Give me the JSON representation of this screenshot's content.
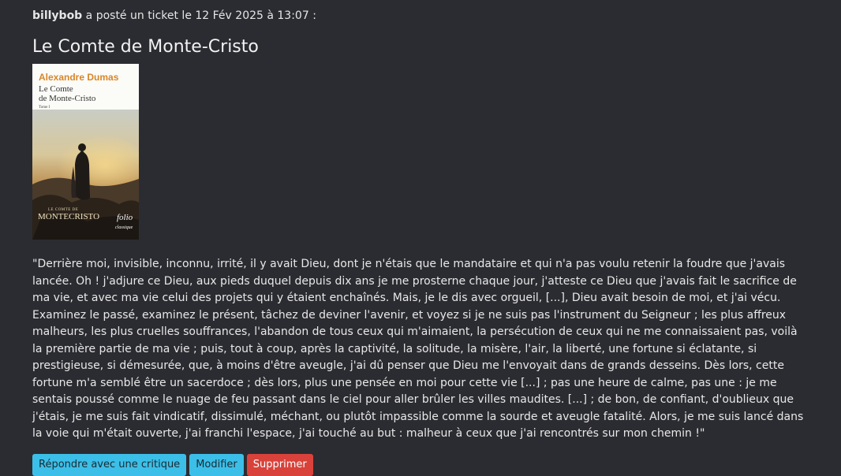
{
  "ticket": {
    "author": "billybob",
    "posted_text": " a posté un ticket le 12 Fév 2025 à 13:07 :",
    "title": "Le Comte de Monte-Cristo",
    "cover": {
      "author": "Alexandre Dumas",
      "title_line1": "Le Comte",
      "title_line2": "de Monte-Cristo",
      "tome": "Tome I",
      "film_small": "LE COMTE DE",
      "film_title": "MONTECRISTO",
      "brand": "folio",
      "collection": "classique"
    },
    "quote": "\"Derrière moi, invisible, inconnu, irrité, il y avait Dieu, dont je n'étais que le mandataire et qui n'a pas voulu retenir la foudre que j'avais lancée. Oh ! j'adjure ce Dieu, aux pieds duquel depuis dix ans je me prosterne chaque jour, j'atteste ce Dieu que j'avais fait le sacrifice de ma vie, et avec ma vie celui des projets qui y étaient enchaînés. Mais, je le dis avec orgueil, [...], Dieu avait besoin de moi, et j'ai vécu. Examinez le passé, examinez le présent, tâchez de deviner l'avenir, et voyez si je ne suis pas l'instrument du Seigneur ; les plus affreux malheurs, les plus cruelles souffrances, l'abandon de tous ceux qui m'aimaient, la persécution de ceux qui ne me connaissaient pas, voilà la première partie de ma vie ; puis, tout à coup, après la captivité, la solitude, la misère, l'air, la liberté, une fortune si éclatante, si prestigieuse, si démesurée, que, à moins d'être aveugle, j'ai dû penser que Dieu me l'envoyait dans de grands desseins. Dès lors, cette fortune m'a semblé être un sacerdoce ; dès lors, plus une pensée en moi pour cette vie [...] ; pas une heure de calme, pas une : je me sentais poussé comme le nuage de feu passant dans le ciel pour aller brûler les villes maudites. [...] ; de bon, de confiant, d'oublieux que j'étais, je me suis fait vindicatif, dissimulé, méchant, ou plutôt impassible comme la sourde et aveugle fatalité. Alors, je me suis lancé dans la voie qui m'était ouverte, j'ai franchi l'espace, j'ai touché au but : malheur à ceux que j'ai rencontrés sur mon chemin !\""
  },
  "actions": {
    "reply_label": "Répondre avec une critique",
    "edit_label": "Modifier",
    "delete_label": "Supprimer"
  },
  "colors": {
    "background": "#2b2c31",
    "info": "#3bbfe8",
    "danger": "#d9423a",
    "cover_author": "#d8862a"
  }
}
